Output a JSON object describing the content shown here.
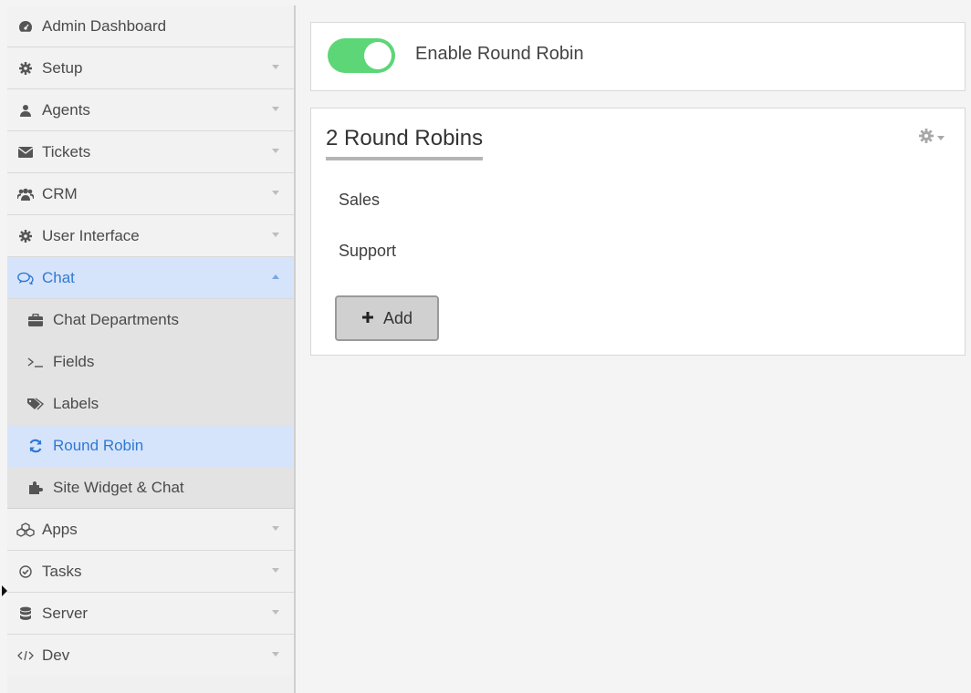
{
  "sidebar": {
    "items": [
      {
        "label": "Admin Dashboard",
        "icon": "dashboard-icon"
      },
      {
        "label": "Setup",
        "icon": "gear-icon"
      },
      {
        "label": "Agents",
        "icon": "user-icon"
      },
      {
        "label": "Tickets",
        "icon": "envelope-icon"
      },
      {
        "label": "CRM",
        "icon": "users-icon"
      },
      {
        "label": "User Interface",
        "icon": "gear-icon"
      },
      {
        "label": "Chat",
        "icon": "chat-icon"
      },
      {
        "label": "Apps",
        "icon": "cubes-icon"
      },
      {
        "label": "Tasks",
        "icon": "check-circle-icon"
      },
      {
        "label": "Server",
        "icon": "database-icon"
      },
      {
        "label": "Dev",
        "icon": "code-icon"
      }
    ],
    "chat_sub": [
      {
        "label": "Chat Departments",
        "icon": "briefcase-icon"
      },
      {
        "label": "Fields",
        "icon": "terminal-icon"
      },
      {
        "label": "Labels",
        "icon": "tags-icon"
      },
      {
        "label": "Round Robin",
        "icon": "refresh-icon"
      },
      {
        "label": "Site Widget & Chat",
        "icon": "puzzle-icon"
      }
    ]
  },
  "toggle": {
    "label": "Enable Round Robin",
    "enabled": true
  },
  "round_robins": {
    "title": "2 Round Robins",
    "items": [
      "Sales",
      "Support"
    ],
    "add_label": "Add"
  },
  "colors": {
    "accent": "#2f79d3",
    "toggle_on": "#5cd677",
    "active_bg": "#d6e4fb"
  }
}
